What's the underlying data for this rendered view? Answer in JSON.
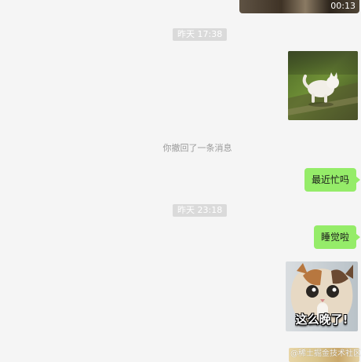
{
  "video": {
    "duration": "00:13",
    "icon": "video-thumbnail"
  },
  "timestamps": [
    "昨天 17:38",
    "昨天 23:18"
  ],
  "recall_notice": "你撤回了一条消息",
  "messages": {
    "bubble_1": "最近忙吗",
    "bubble_2": "睡觉啦"
  },
  "images": {
    "cat_photo_1": "cat-running-photo",
    "cat_sticker": {
      "caption": "这么晚了!"
    },
    "partial_image": {
      "watermark": "@稀土掘金技术社区"
    }
  },
  "colors": {
    "background": "#f5f5f5",
    "sent_bubble": "#95ec69",
    "timestamp_chip": "#dadada",
    "system_text": "#9a9a9a"
  }
}
